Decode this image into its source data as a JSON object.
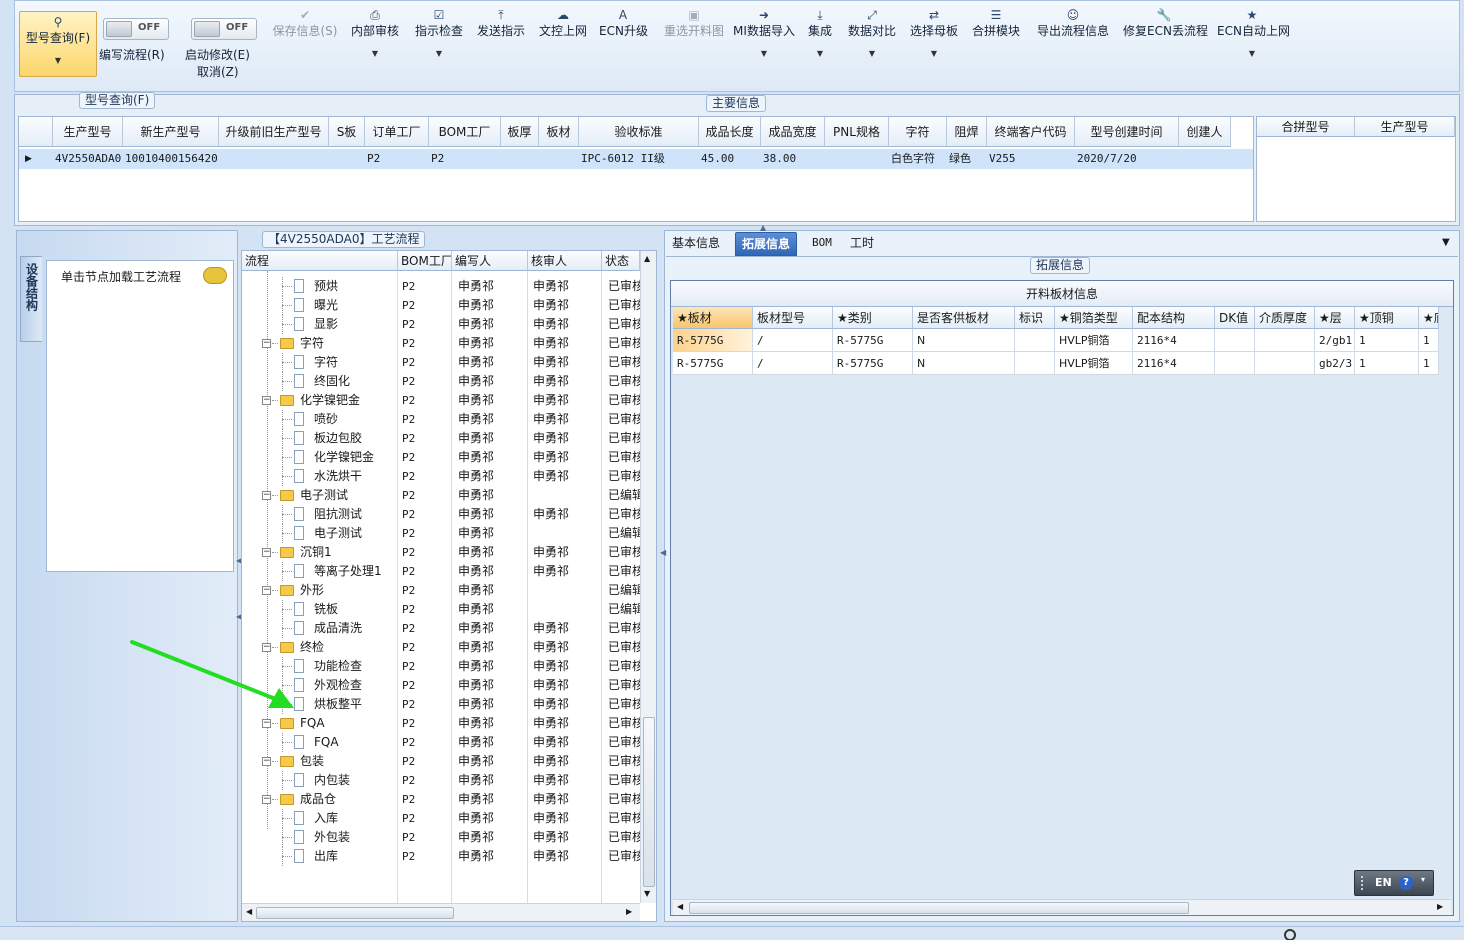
{
  "toolbar": {
    "query_label": "型号查询(F)",
    "write_flow_toggle": "OFF",
    "write_flow_label": "编写流程(R)",
    "start_modify_toggle": "OFF",
    "start_modify_label": "启动修改(E)",
    "cancel_label": "取消(Z)",
    "buttons": [
      {
        "label": "保存信息(S)",
        "icon": "check-icon"
      },
      {
        "label": "内部审核",
        "icon": "printer-icon"
      },
      {
        "label": "指示检查",
        "icon": "checkbox-icon"
      },
      {
        "label": "发送指示",
        "icon": "upload-icon"
      },
      {
        "label": "文控上网",
        "icon": "cloud-upload-icon"
      },
      {
        "label": "ECN升级",
        "icon": "font-icon"
      },
      {
        "label": "重选开料图",
        "icon": "image-icon"
      },
      {
        "label": "MI数据导入",
        "icon": "sign-in-icon"
      },
      {
        "label": "集成",
        "icon": "download-icon"
      },
      {
        "label": "数据对比",
        "icon": "compress-icon"
      },
      {
        "label": "选择母板",
        "icon": "shuffle-icon"
      },
      {
        "label": "合拼模块",
        "icon": "list-icon"
      },
      {
        "label": "导出流程信息",
        "icon": "smile-icon"
      },
      {
        "label": "修复ECN丢流程",
        "icon": "wrench-icon"
      },
      {
        "label": "ECN自动上网",
        "icon": "star-icon"
      }
    ]
  },
  "query_group": {
    "caption": "型号查询(F)"
  },
  "main_info": {
    "caption": "主要信息",
    "columns": [
      "生产型号",
      "新生产型号",
      "升级前旧生产型号",
      "S板",
      "订单工厂",
      "BOM工厂",
      "板厚",
      "板材",
      "验收标准",
      "成品长度",
      "成品宽度",
      "PNL规格",
      "字符",
      "阻焊",
      "终端客户代码",
      "型号创建时间",
      "创建人"
    ],
    "row": {
      "生产型号": "4V2550ADA0",
      "新生产型号": "10010400156420",
      "订单工厂": "P2",
      "BOM工厂": "P2",
      "验收标准": "IPC-6012 II级",
      "成品长度": "45.00",
      "成品宽度": "38.00",
      "字符": "白色字符",
      "阻焊": "绿色",
      "终端客户代码": "V255",
      "型号创建时间": "2020/7/20"
    },
    "side_columns": [
      "合拼型号",
      "生产型号"
    ]
  },
  "process_panel": {
    "caption": "【4V2550ADA0】工艺流程",
    "side_tab": "设备结构",
    "node_hint": "单击节点加载工艺流程",
    "columns": [
      "流程",
      "BOM工厂",
      "编写人",
      "核审人",
      "状态"
    ],
    "rows": [
      {
        "type": "item",
        "name": "预烘",
        "bom": "P2",
        "writer": "申勇祁",
        "reviewer": "申勇祁",
        "status": "已审核"
      },
      {
        "type": "item",
        "name": "曝光",
        "bom": "P2",
        "writer": "申勇祁",
        "reviewer": "申勇祁",
        "status": "已审核"
      },
      {
        "type": "item",
        "name": "显影",
        "bom": "P2",
        "writer": "申勇祁",
        "reviewer": "申勇祁",
        "status": "已审核"
      },
      {
        "type": "folder",
        "name": "字符",
        "bom": "P2",
        "writer": "申勇祁",
        "reviewer": "申勇祁",
        "status": "已审核"
      },
      {
        "type": "item",
        "name": "字符",
        "bom": "P2",
        "writer": "申勇祁",
        "reviewer": "申勇祁",
        "status": "已审核"
      },
      {
        "type": "item",
        "name": "终固化",
        "bom": "P2",
        "writer": "申勇祁",
        "reviewer": "申勇祁",
        "status": "已审核"
      },
      {
        "type": "folder",
        "name": "化学镍钯金",
        "bom": "P2",
        "writer": "申勇祁",
        "reviewer": "申勇祁",
        "status": "已审核"
      },
      {
        "type": "item",
        "name": "喷砂",
        "bom": "P2",
        "writer": "申勇祁",
        "reviewer": "申勇祁",
        "status": "已审核"
      },
      {
        "type": "item",
        "name": "板边包胶",
        "bom": "P2",
        "writer": "申勇祁",
        "reviewer": "申勇祁",
        "status": "已审核"
      },
      {
        "type": "item",
        "name": "化学镍钯金",
        "bom": "P2",
        "writer": "申勇祁",
        "reviewer": "申勇祁",
        "status": "已审核"
      },
      {
        "type": "item",
        "name": "水洗烘干",
        "bom": "P2",
        "writer": "申勇祁",
        "reviewer": "申勇祁",
        "status": "已审核"
      },
      {
        "type": "folder",
        "name": "电子测试",
        "bom": "P2",
        "writer": "申勇祁",
        "reviewer": "",
        "status": "已编辑"
      },
      {
        "type": "item",
        "name": "阻抗测试",
        "bom": "P2",
        "writer": "申勇祁",
        "reviewer": "申勇祁",
        "status": "已审核"
      },
      {
        "type": "item",
        "name": "电子测试",
        "bom": "P2",
        "writer": "申勇祁",
        "reviewer": "",
        "status": "已编辑"
      },
      {
        "type": "folder",
        "name": "沉铜1",
        "bom": "P2",
        "writer": "申勇祁",
        "reviewer": "申勇祁",
        "status": "已审核"
      },
      {
        "type": "item",
        "name": "等离子处理1",
        "bom": "P2",
        "writer": "申勇祁",
        "reviewer": "申勇祁",
        "status": "已审核"
      },
      {
        "type": "folder",
        "name": "外形",
        "bom": "P2",
        "writer": "申勇祁",
        "reviewer": "",
        "status": "已编辑"
      },
      {
        "type": "item",
        "name": "铣板",
        "bom": "P2",
        "writer": "申勇祁",
        "reviewer": "",
        "status": "已编辑"
      },
      {
        "type": "item",
        "name": "成品清洗",
        "bom": "P2",
        "writer": "申勇祁",
        "reviewer": "申勇祁",
        "status": "已审核"
      },
      {
        "type": "folder",
        "name": "终检",
        "bom": "P2",
        "writer": "申勇祁",
        "reviewer": "申勇祁",
        "status": "已审核"
      },
      {
        "type": "item",
        "name": "功能检查",
        "bom": "P2",
        "writer": "申勇祁",
        "reviewer": "申勇祁",
        "status": "已审核"
      },
      {
        "type": "item",
        "name": "外观检查",
        "bom": "P2",
        "writer": "申勇祁",
        "reviewer": "申勇祁",
        "status": "已审核"
      },
      {
        "type": "item",
        "name": "烘板整平",
        "bom": "P2",
        "writer": "申勇祁",
        "reviewer": "申勇祁",
        "status": "已审核"
      },
      {
        "type": "folder",
        "name": "FQA",
        "bom": "P2",
        "writer": "申勇祁",
        "reviewer": "申勇祁",
        "status": "已审核"
      },
      {
        "type": "item",
        "name": "FQA",
        "bom": "P2",
        "writer": "申勇祁",
        "reviewer": "申勇祁",
        "status": "已审核"
      },
      {
        "type": "folder",
        "name": "包装",
        "bom": "P2",
        "writer": "申勇祁",
        "reviewer": "申勇祁",
        "status": "已审核"
      },
      {
        "type": "item",
        "name": "内包装",
        "bom": "P2",
        "writer": "申勇祁",
        "reviewer": "申勇祁",
        "status": "已审核"
      },
      {
        "type": "folder",
        "name": "成品仓",
        "bom": "P2",
        "writer": "申勇祁",
        "reviewer": "申勇祁",
        "status": "已审核"
      },
      {
        "type": "item",
        "name": "入库",
        "bom": "P2",
        "writer": "申勇祁",
        "reviewer": "申勇祁",
        "status": "已审核"
      },
      {
        "type": "item",
        "name": "外包装",
        "bom": "P2",
        "writer": "申勇祁",
        "reviewer": "申勇祁",
        "status": "已审核"
      },
      {
        "type": "item",
        "name": "出库",
        "bom": "P2",
        "writer": "申勇祁",
        "reviewer": "申勇祁",
        "status": "已审核"
      }
    ]
  },
  "right_panel": {
    "tabs": [
      "基本信息",
      "拓展信息",
      "BOM",
      "工时"
    ],
    "active_tab": "拓展信息",
    "group_caption": "拓展信息",
    "sheet_title": "开料板材信息",
    "columns": [
      "★板材",
      "板材型号",
      "★类别",
      "是否客供板材",
      "标识",
      "★铜箔类型",
      "配本结构",
      "DK值",
      "介质厚度",
      "★层",
      "★顶铜",
      "★底"
    ],
    "rows": [
      [
        "R-5775G",
        "/",
        "R-5775G",
        "N",
        "",
        "HVLP铜箔",
        "2116*4",
        "",
        "",
        "2/gb1",
        "1",
        "1"
      ],
      [
        "R-5775G",
        "/",
        "R-5775G",
        "N",
        "",
        "HVLP铜箔",
        "2116*4",
        "",
        "",
        "gb2/3",
        "1",
        "1"
      ]
    ]
  },
  "ime": {
    "label": "EN"
  },
  "colors": {
    "arrow": "#22dd22",
    "active_tab": "#2f66b8",
    "selected_row": "#cfe3fb",
    "highlight_cell": "#fbd38c"
  }
}
